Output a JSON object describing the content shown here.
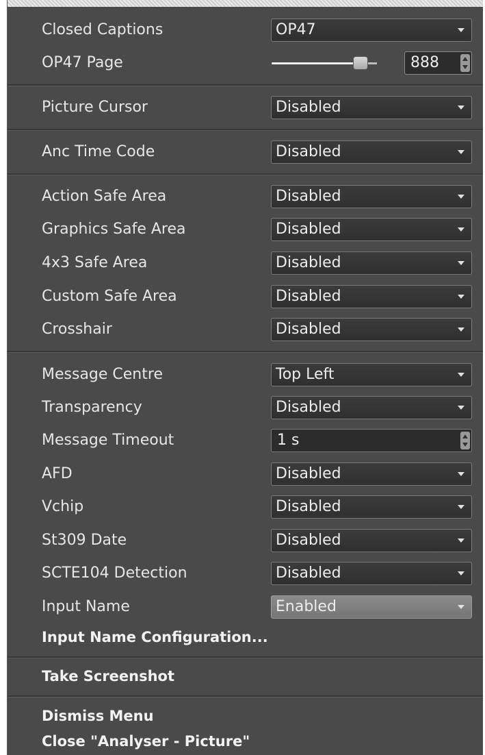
{
  "menu": {
    "closed_captions": {
      "label": "Closed Captions",
      "value": "OP47"
    },
    "op47_page": {
      "label": "OP47 Page",
      "value": "888"
    },
    "picture_cursor": {
      "label": "Picture Cursor",
      "value": "Disabled"
    },
    "anc_time_code": {
      "label": "Anc Time Code",
      "value": "Disabled"
    },
    "action_safe_area": {
      "label": "Action Safe Area",
      "value": "Disabled"
    },
    "graphics_safe_area": {
      "label": "Graphics Safe Area",
      "value": "Disabled"
    },
    "safe_area_4x3": {
      "label": "4x3 Safe Area",
      "value": "Disabled"
    },
    "custom_safe_area": {
      "label": "Custom Safe Area",
      "value": "Disabled"
    },
    "crosshair": {
      "label": "Crosshair",
      "value": "Disabled"
    },
    "message_centre": {
      "label": "Message Centre",
      "value": "Top Left"
    },
    "transparency": {
      "label": "Transparency",
      "value": "Disabled"
    },
    "message_timeout": {
      "label": "Message Timeout",
      "value": "1 s"
    },
    "afd": {
      "label": "AFD",
      "value": "Disabled"
    },
    "vchip": {
      "label": "Vchip",
      "value": "Disabled"
    },
    "st309_date": {
      "label": "St309 Date",
      "value": "Disabled"
    },
    "scte104_detection": {
      "label": "SCTE104 Detection",
      "value": "Disabled"
    },
    "input_name": {
      "label": "Input Name",
      "value": "Enabled"
    },
    "input_name_configuration": "Input Name Configuration...",
    "take_screenshot": "Take Screenshot",
    "dismiss_menu": "Dismiss Menu",
    "close_window": "Close \"Analyser - Picture\""
  }
}
